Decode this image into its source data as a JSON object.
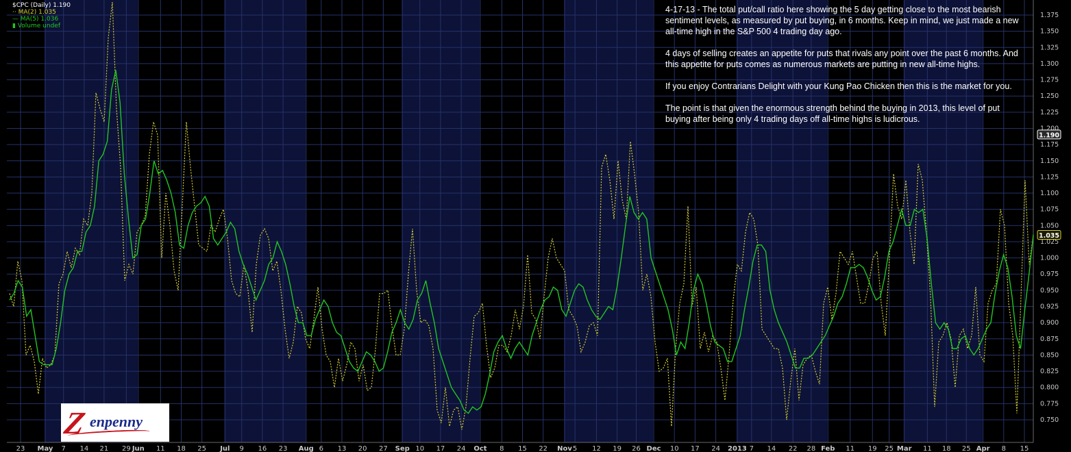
{
  "legend": {
    "title": "$CPC (Daily) 1.190",
    "ma2": "MA(2) 1.035",
    "ma5": "MA(5) 1.036",
    "volume": "Volume undef"
  },
  "annotation": {
    "p1": "4-17-13 - The total put/call ratio here showing the 5 day getting close to the most bearish sentiment levels, as measured by put buying, in 6 months. Keep in mind, we just made a new all-time high in the S&P 500 4 trading day ago.",
    "p2": "4 days of selling creates an appetite for puts that rivals any point over the past 6 months. And this appetite for puts comes as numerous markets are putting in new all-time highs.",
    "p3": "If you enjoy Contrarians Delight with your Kung Pao Chicken then this is the market for you.",
    "p4": "The point is that given the enormous strength behind the buying in 2013, this level of put buying after being only 4 trading days off all-time highs is ludicrous."
  },
  "logo": {
    "z": "Z",
    "text": "enpenny"
  },
  "colors": {
    "background": "#000000",
    "shaded_month": "#0d1238",
    "grid": "#253268",
    "ma2_line": "#d8d030",
    "ma5_line": "#22c522",
    "axis_text": "#c8c8c8"
  },
  "chart_data": {
    "type": "line",
    "title": "$CPC (Daily) 1.190",
    "ylim": [
      0.725,
      1.395
    ],
    "yticks": [
      0.75,
      0.775,
      0.8,
      0.825,
      0.85,
      0.875,
      0.9,
      0.925,
      0.95,
      0.975,
      1.0,
      1.025,
      1.05,
      1.075,
      1.1,
      1.125,
      1.15,
      1.175,
      1.2,
      1.225,
      1.25,
      1.275,
      1.3,
      1.325,
      1.35,
      1.375
    ],
    "price_markers": [
      {
        "label": "1.190",
        "value": 1.19,
        "style": "white"
      },
      {
        "label": "1.035",
        "value": 1.035,
        "style": "yellow"
      }
    ],
    "x_labels": [
      {
        "label": "23",
        "pos": 0.0,
        "bold": false
      },
      {
        "label": "May",
        "pos": 0.031,
        "bold": true
      },
      {
        "label": "7",
        "pos": 0.054,
        "bold": false
      },
      {
        "label": "14",
        "pos": 0.08,
        "bold": false
      },
      {
        "label": "21",
        "pos": 0.105,
        "bold": false
      },
      {
        "label": "29",
        "pos": 0.133,
        "bold": false
      },
      {
        "label": "Jun",
        "pos": 0.148,
        "bold": true
      },
      {
        "label": "11",
        "pos": 0.176,
        "bold": false
      },
      {
        "label": "18",
        "pos": 0.202,
        "bold": false
      },
      {
        "label": "25",
        "pos": 0.228,
        "bold": false
      },
      {
        "label": "Jul",
        "pos": 0.257,
        "bold": true
      },
      {
        "label": "9",
        "pos": 0.278,
        "bold": false
      },
      {
        "label": "16",
        "pos": 0.304,
        "bold": false
      },
      {
        "label": "23",
        "pos": 0.33,
        "bold": false
      },
      {
        "label": "Aug",
        "pos": 0.359,
        "bold": true
      },
      {
        "label": "6",
        "pos": 0.378,
        "bold": false
      },
      {
        "label": "13",
        "pos": 0.404,
        "bold": false
      },
      {
        "label": "20",
        "pos": 0.43,
        "bold": false
      },
      {
        "label": "27",
        "pos": 0.456,
        "bold": false
      },
      {
        "label": "Sep",
        "pos": 0.48,
        "bold": true
      },
      {
        "label": "10",
        "pos": 0.502,
        "bold": false
      },
      {
        "label": "17",
        "pos": 0.528,
        "bold": false
      },
      {
        "label": "24",
        "pos": 0.554,
        "bold": false
      },
      {
        "label": "Oct",
        "pos": 0.578,
        "bold": true
      },
      {
        "label": "8",
        "pos": 0.605,
        "bold": false
      },
      {
        "label": "15",
        "pos": 0.631,
        "bold": false
      },
      {
        "label": "22",
        "pos": 0.657,
        "bold": false
      },
      {
        "label": "Nov",
        "pos": 0.684,
        "bold": true
      },
      {
        "label": "5",
        "pos": 0.697,
        "bold": false
      },
      {
        "label": "12",
        "pos": 0.724,
        "bold": false
      },
      {
        "label": "19",
        "pos": 0.75,
        "bold": false
      },
      {
        "label": "26",
        "pos": 0.774,
        "bold": false
      },
      {
        "label": "Dec",
        "pos": 0.796,
        "bold": true
      },
      {
        "label": "10",
        "pos": 0.822,
        "bold": false
      },
      {
        "label": "17",
        "pos": 0.848,
        "bold": false
      },
      {
        "label": "24",
        "pos": 0.874,
        "bold": false
      },
      {
        "label": "2013",
        "pos": 0.901,
        "bold": true
      },
      {
        "label": "7",
        "pos": 0.919,
        "bold": false
      },
      {
        "label": "14",
        "pos": 0.944,
        "bold": false
      },
      {
        "label": "22",
        "pos": 0.971,
        "bold": false
      },
      {
        "label": "28",
        "pos": 0.994,
        "bold": false
      },
      {
        "label": "Feb",
        "pos": 1.015,
        "bold": true
      },
      {
        "label": "11",
        "pos": 1.043,
        "bold": false
      },
      {
        "label": "19",
        "pos": 1.071,
        "bold": false
      },
      {
        "label": "25",
        "pos": 1.092,
        "bold": false
      },
      {
        "label": "Mar",
        "pos": 1.111,
        "bold": true
      },
      {
        "label": "11",
        "pos": 1.14,
        "bold": false
      },
      {
        "label": "18",
        "pos": 1.164,
        "bold": false
      },
      {
        "label": "25",
        "pos": 1.189,
        "bold": false
      },
      {
        "label": "Apr",
        "pos": 1.21,
        "bold": true
      },
      {
        "label": "8",
        "pos": 1.236,
        "bold": false
      },
      {
        "label": "15",
        "pos": 1.262,
        "bold": false
      }
    ],
    "shaded_months": [
      [
        0.031,
        0.148
      ],
      [
        0.257,
        0.359
      ],
      [
        0.48,
        0.578
      ],
      [
        0.684,
        0.796
      ],
      [
        0.901,
        1.015
      ],
      [
        1.111,
        1.21
      ]
    ],
    "series": [
      {
        "name": "MA(2)",
        "style": "dotted",
        "values": [
          0.945,
          0.925,
          0.995,
          0.965,
          0.85,
          0.865,
          0.84,
          0.79,
          0.845,
          0.83,
          0.835,
          0.85,
          0.96,
          0.975,
          1.01,
          0.985,
          1.015,
          1.005,
          1.06,
          1.05,
          1.1,
          1.255,
          1.23,
          1.21,
          1.34,
          1.395,
          1.23,
          1.14,
          0.965,
          0.99,
          0.975,
          1.04,
          1.05,
          1.065,
          1.16,
          1.21,
          1.19,
          1.0,
          1.1,
          1.05,
          0.98,
          0.95,
          1.08,
          1.21,
          1.14,
          1.08,
          1.02,
          1.015,
          1.01,
          1.05,
          1.04,
          1.06,
          1.075,
          1.03,
          0.965,
          0.945,
          0.94,
          0.99,
          0.95,
          0.885,
          0.99,
          1.035,
          1.045,
          1.03,
          0.98,
          0.995,
          0.95,
          0.89,
          0.845,
          0.87,
          0.925,
          0.915,
          0.875,
          0.86,
          0.905,
          0.955,
          0.89,
          0.85,
          0.84,
          0.8,
          0.845,
          0.81,
          0.835,
          0.87,
          0.86,
          0.81,
          0.835,
          0.795,
          0.8,
          0.86,
          0.945,
          0.945,
          0.95,
          0.895,
          0.85,
          0.85,
          0.89,
          0.975,
          1.045,
          0.95,
          0.9,
          0.905,
          0.895,
          0.86,
          0.765,
          0.745,
          0.8,
          0.74,
          0.765,
          0.77,
          0.735,
          0.77,
          0.845,
          0.91,
          0.915,
          0.93,
          0.865,
          0.815,
          0.83,
          0.865,
          0.865,
          0.855,
          0.88,
          0.92,
          0.89,
          0.925,
          1.005,
          0.915,
          0.905,
          0.875,
          0.94,
          1.0,
          1.03,
          1.0,
          0.99,
          0.98,
          0.92,
          0.91,
          0.895,
          0.855,
          0.87,
          0.895,
          0.9,
          0.88,
          1.14,
          1.16,
          1.12,
          1.06,
          1.15,
          1.09,
          1.06,
          1.18,
          1.13,
          1.07,
          0.95,
          0.975,
          0.94,
          0.87,
          0.825,
          0.83,
          0.845,
          0.74,
          0.86,
          0.93,
          0.96,
          1.08,
          0.925,
          0.955,
          0.86,
          0.885,
          0.855,
          0.88,
          0.87,
          0.83,
          0.78,
          0.85,
          0.935,
          0.99,
          0.98,
          1.04,
          1.07,
          1.06,
          1.02,
          0.89,
          0.88,
          0.87,
          0.86,
          0.86,
          0.83,
          0.75,
          0.81,
          0.86,
          0.78,
          0.835,
          0.845,
          0.85,
          0.825,
          0.805,
          0.93,
          0.955,
          0.905,
          0.945,
          1.01,
          1.0,
          0.99,
          1.01,
          0.97,
          0.93,
          0.93,
          0.96,
          1.0,
          1.01,
          0.93,
          0.88,
          1.0,
          1.13,
          1.08,
          1.06,
          1.12,
          1.04,
          0.99,
          1.145,
          1.12,
          1.04,
          0.94,
          0.77,
          0.87,
          0.88,
          0.9,
          0.875,
          0.8,
          0.88,
          0.89,
          0.86,
          0.88,
          0.955,
          0.85,
          0.84,
          0.93,
          0.95,
          0.96,
          1.075,
          1.05,
          0.93,
          0.88,
          0.76,
          0.94,
          1.12,
          0.99,
          1.035
        ]
      },
      {
        "name": "MA(5)",
        "style": "solid",
        "values": [
          0.935,
          0.945,
          0.965,
          0.955,
          0.91,
          0.92,
          0.88,
          0.84,
          0.835,
          0.835,
          0.835,
          0.86,
          0.9,
          0.95,
          0.975,
          0.985,
          1.01,
          1.01,
          1.04,
          1.05,
          1.08,
          1.15,
          1.16,
          1.18,
          1.26,
          1.29,
          1.24,
          1.13,
          1.06,
          1.0,
          1.005,
          1.05,
          1.06,
          1.1,
          1.15,
          1.13,
          1.135,
          1.12,
          1.1,
          1.07,
          1.02,
          1.015,
          1.05,
          1.07,
          1.08,
          1.085,
          1.095,
          1.08,
          1.03,
          1.02,
          1.03,
          1.04,
          1.055,
          1.045,
          1.01,
          0.99,
          0.975,
          0.955,
          0.935,
          0.95,
          0.965,
          0.99,
          1.0,
          1.025,
          1.01,
          0.99,
          0.96,
          0.925,
          0.9,
          0.9,
          0.88,
          0.88,
          0.905,
          0.92,
          0.935,
          0.925,
          0.9,
          0.885,
          0.88,
          0.86,
          0.84,
          0.83,
          0.825,
          0.84,
          0.855,
          0.85,
          0.84,
          0.825,
          0.83,
          0.855,
          0.885,
          0.9,
          0.92,
          0.9,
          0.89,
          0.905,
          0.935,
          0.945,
          0.965,
          0.93,
          0.9,
          0.86,
          0.84,
          0.82,
          0.8,
          0.79,
          0.78,
          0.765,
          0.76,
          0.77,
          0.765,
          0.77,
          0.79,
          0.82,
          0.855,
          0.87,
          0.88,
          0.86,
          0.845,
          0.86,
          0.87,
          0.86,
          0.85,
          0.88,
          0.9,
          0.92,
          0.935,
          0.94,
          0.955,
          0.95,
          0.92,
          0.91,
          0.93,
          0.95,
          0.96,
          0.955,
          0.935,
          0.92,
          0.91,
          0.905,
          0.915,
          0.925,
          0.92,
          0.955,
          1.0,
          1.05,
          1.095,
          1.07,
          1.06,
          1.07,
          1.06,
          1.0,
          0.98,
          0.96,
          0.94,
          0.92,
          0.89,
          0.85,
          0.87,
          0.86,
          0.9,
          0.95,
          0.975,
          0.96,
          0.93,
          0.895,
          0.87,
          0.865,
          0.86,
          0.84,
          0.84,
          0.86,
          0.88,
          0.92,
          0.955,
          0.995,
          1.02,
          1.02,
          1.01,
          0.95,
          0.92,
          0.9,
          0.885,
          0.87,
          0.85,
          0.83,
          0.83,
          0.845,
          0.845,
          0.85,
          0.86,
          0.87,
          0.88,
          0.895,
          0.91,
          0.93,
          0.94,
          0.96,
          0.985,
          0.985,
          0.99,
          0.985,
          0.97,
          0.95,
          0.935,
          0.94,
          0.97,
          1.01,
          1.025,
          1.05,
          1.075,
          1.05,
          1.05,
          1.075,
          1.07,
          1.075,
          1.03,
          0.96,
          0.9,
          0.89,
          0.9,
          0.89,
          0.86,
          0.86,
          0.875,
          0.88,
          0.86,
          0.85,
          0.86,
          0.875,
          0.89,
          0.9,
          0.945,
          0.98,
          1.005,
          0.985,
          0.94,
          0.88,
          0.86,
          0.92,
          0.975,
          1.036
        ]
      }
    ]
  }
}
